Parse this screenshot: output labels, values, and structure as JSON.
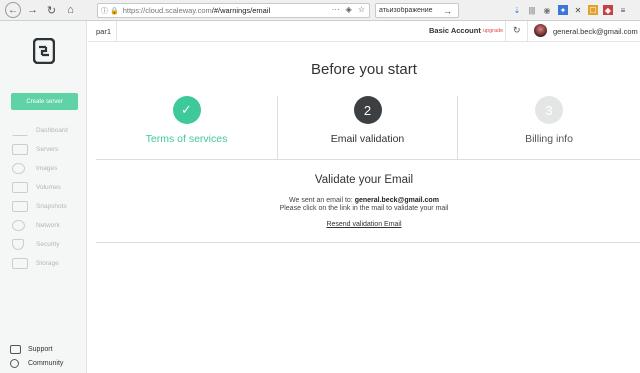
{
  "browser": {
    "url_host": "https://cloud.scaleway.com",
    "url_path": "/#/warnings/email",
    "search_text": "атьизображение"
  },
  "sidebar": {
    "create_button": "Create server",
    "items": [
      {
        "label": "Dashboard",
        "icon": "chart-icon"
      },
      {
        "label": "Servers",
        "icon": "server-icon"
      },
      {
        "label": "Images",
        "icon": "image-icon"
      },
      {
        "label": "Volumes",
        "icon": "volume-icon"
      },
      {
        "label": "Snapshots",
        "icon": "snapshot-icon"
      },
      {
        "label": "Network",
        "icon": "network-icon"
      },
      {
        "label": "Security",
        "icon": "shield-icon"
      },
      {
        "label": "Storage",
        "icon": "storage-icon"
      }
    ],
    "footer": [
      {
        "label": "Support",
        "icon": "chat-icon"
      },
      {
        "label": "Community",
        "icon": "people-icon"
      }
    ]
  },
  "header": {
    "org": "par1",
    "account": "Basic Account",
    "upgrade": "upgrade",
    "email": "general.beck@gmail.com"
  },
  "main": {
    "title": "Before you start",
    "steps": [
      {
        "number": "✓",
        "label": "Terms of services",
        "state": "done"
      },
      {
        "number": "2",
        "label": "Email validation",
        "state": "current"
      },
      {
        "number": "3",
        "label": "Billing info",
        "state": "todo"
      }
    ],
    "section_title": "Validate your Email",
    "sent_prefix": "We sent an email to:",
    "sent_email": "general.beck@gmail.com",
    "instruction": "Please click on the link in the mail to validate your mail",
    "resend": "Resend validation Email"
  },
  "colors": {
    "accent": "#5fd2a6",
    "done": "#3ec99a",
    "current": "#3d4043",
    "todo": "#e4e6e6"
  }
}
